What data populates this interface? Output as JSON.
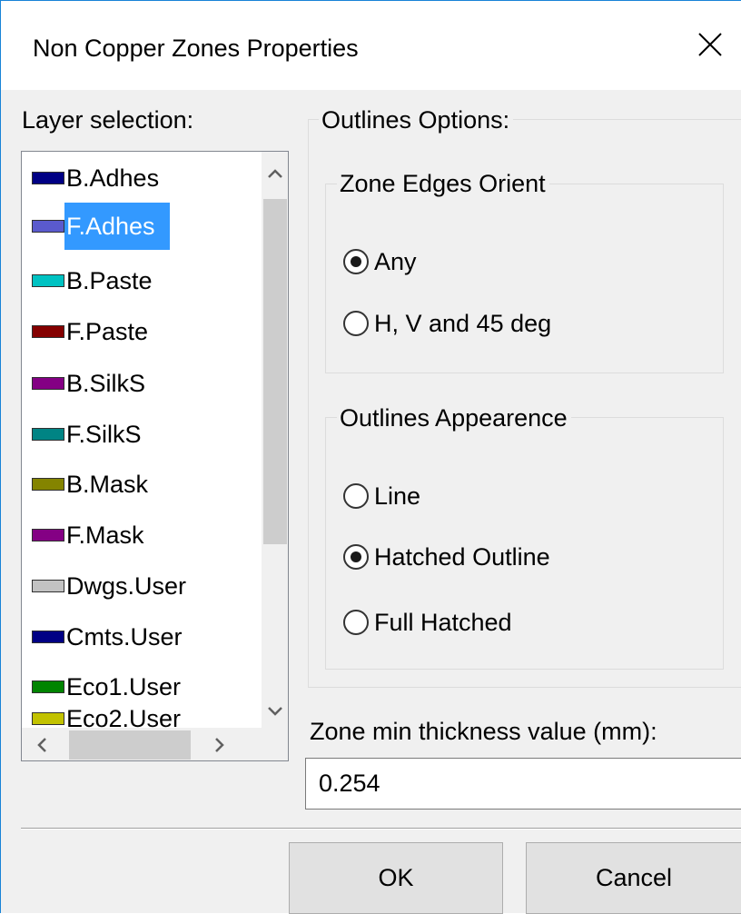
{
  "dialog": {
    "title": "Non Copper Zones Properties"
  },
  "layer_selection": {
    "label": "Layer selection:",
    "selected": "F.Adhes",
    "items": [
      {
        "name": "B.Adhes",
        "color": "#000084"
      },
      {
        "name": "F.Adhes",
        "color": "#5a5acd"
      },
      {
        "name": "B.Paste",
        "color": "#00c2c2"
      },
      {
        "name": "F.Paste",
        "color": "#840000"
      },
      {
        "name": "B.SilkS",
        "color": "#840084"
      },
      {
        "name": "F.SilkS",
        "color": "#008484"
      },
      {
        "name": "B.Mask",
        "color": "#848400"
      },
      {
        "name": "F.Mask",
        "color": "#840084"
      },
      {
        "name": "Dwgs.User",
        "color": "#c2c2c2"
      },
      {
        "name": "Cmts.User",
        "color": "#000084"
      },
      {
        "name": "Eco1.User",
        "color": "#008400"
      },
      {
        "name": "Eco2.User",
        "color": "#c2c200"
      }
    ]
  },
  "outlines_options": {
    "label": "Outlines Options:",
    "zone_edges_orient": {
      "label": "Zone Edges Orient",
      "options": [
        "Any",
        "H, V and 45 deg"
      ],
      "selected": "Any"
    },
    "outlines_appearence": {
      "label": "Outlines Appearence",
      "options": [
        "Line",
        "Hatched Outline",
        "Full Hatched"
      ],
      "selected": "Hatched Outline"
    }
  },
  "min_thickness": {
    "label": "Zone min thickness value (mm):",
    "value": "0.254"
  },
  "buttons": {
    "ok": "OK",
    "cancel": "Cancel"
  },
  "icons": {
    "close": "close-icon",
    "scroll_up": "chevron-up-icon",
    "scroll_down": "chevron-down-icon",
    "scroll_left": "chevron-left-icon",
    "scroll_right": "chevron-right-icon"
  }
}
